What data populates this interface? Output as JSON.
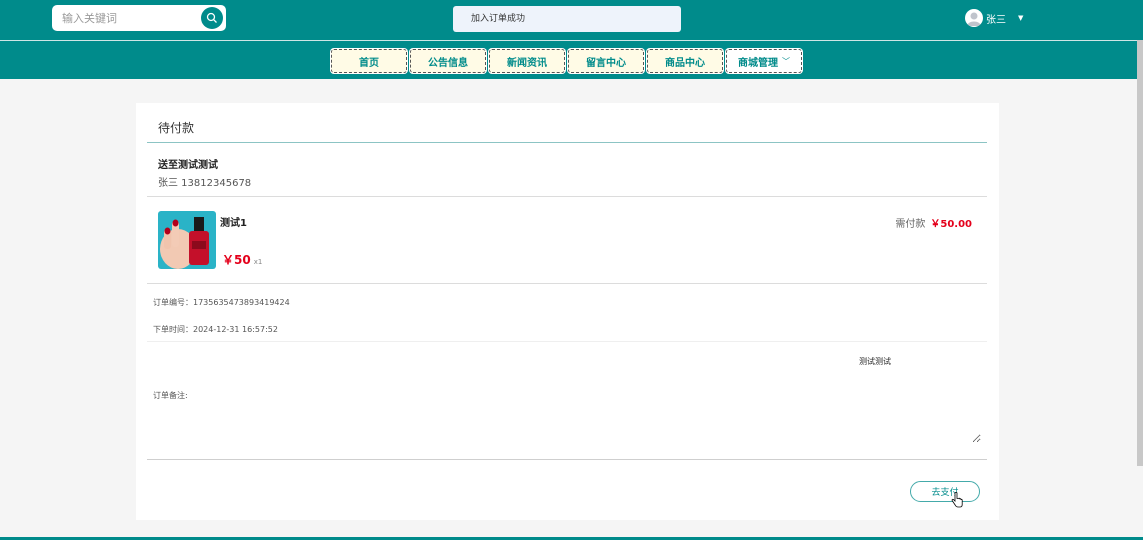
{
  "search": {
    "placeholder": "输入关键词"
  },
  "toast": {
    "message": "加入订单成功"
  },
  "user": {
    "name": "张三"
  },
  "nav": {
    "items": [
      "首页",
      "公告信息",
      "新闻资讯",
      "留言中心",
      "商品中心",
      "商城管理"
    ]
  },
  "order": {
    "status": "待付款",
    "address": "送至测试测试",
    "contact": "张三 13812345678",
    "product": {
      "name": "测试1",
      "price": "￥50",
      "qty": "x1"
    },
    "need_pay_label": "需付款",
    "need_pay_amount": "￥50.00",
    "order_no": "订单编号：1735635473893419424",
    "order_time": "下单时间：2024-12-31 16:57:52",
    "remark_label": "订单备注:",
    "remark_value": "测试测试",
    "pay_button": "去支付"
  },
  "colors": {
    "primary": "#008b8b",
    "price": "#e4001b",
    "nav_bg": "#fffbe6"
  }
}
